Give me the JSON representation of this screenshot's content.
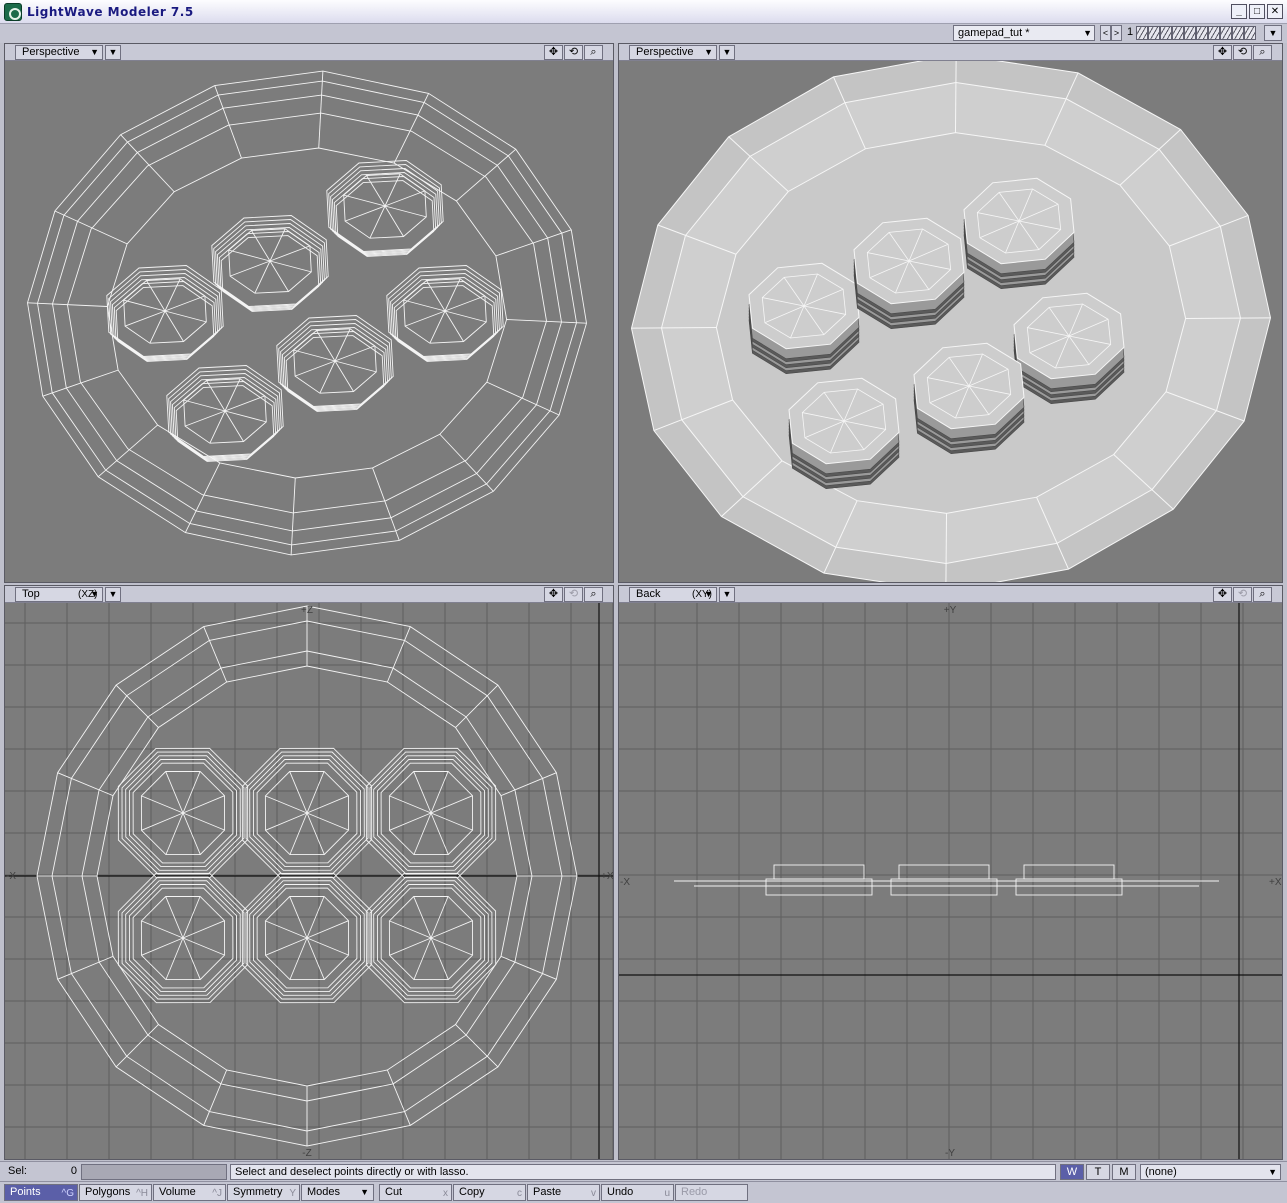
{
  "window": {
    "title": "LightWave Modeler 7.5",
    "min": "_",
    "max": "□",
    "close": "✕"
  },
  "toolbar": {
    "document": "gamepad_tut *",
    "prev": "<",
    "next": ">",
    "layer_number": "1"
  },
  "viewports": {
    "tl": {
      "view": "Perspective"
    },
    "tr": {
      "view": "Perspective"
    },
    "bl": {
      "view": "Top",
      "axis": "(XZ)",
      "labels": {
        "top": "+Z",
        "bottom": "-Z",
        "left": "-X",
        "right": "+X"
      }
    },
    "br": {
      "view": "Back",
      "axis": "(XY)",
      "labels": {
        "top": "+Y",
        "bottom": "-Y",
        "left": "-X",
        "right": "+X"
      }
    }
  },
  "status": {
    "sel_label": "Sel:",
    "sel_value": "0",
    "hint": "Select and deselect points directly or with lasso.",
    "w": "W",
    "t": "T",
    "m": "M",
    "surface": "(none)"
  },
  "bottom": {
    "points": "Points",
    "points_key": "^G",
    "polygons": "Polygons",
    "polygons_key": "^H",
    "volume": "Volume",
    "volume_key": "^J",
    "symmetry": "Symmetry",
    "symmetry_key": "Y",
    "modes": "Modes",
    "cut": "Cut",
    "cut_key": "x",
    "copy": "Copy",
    "copy_key": "c",
    "paste": "Paste",
    "paste_key": "v",
    "undo": "Undo",
    "undo_key": "u",
    "redo": "Redo"
  }
}
